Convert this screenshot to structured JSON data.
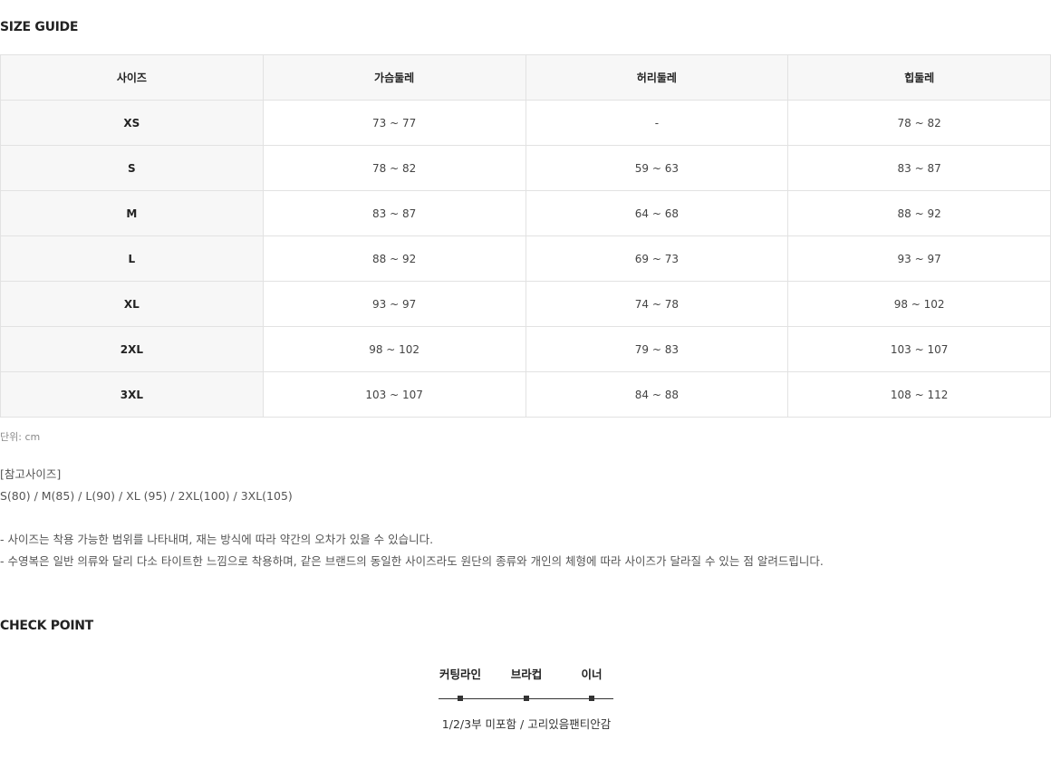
{
  "size_guide": {
    "title": "SIZE GUIDE",
    "headers": [
      "사이즈",
      "가슴둘레",
      "허리둘레",
      "힙둘레"
    ],
    "rows": [
      [
        "XS",
        "73 ~ 77",
        "-",
        "78 ~ 82"
      ],
      [
        "S",
        "78 ~ 82",
        "59 ~ 63",
        "83 ~ 87"
      ],
      [
        "M",
        "83 ~ 87",
        "64 ~ 68",
        "88 ~ 92"
      ],
      [
        "L",
        "88 ~ 92",
        "69 ~ 73",
        "93 ~ 97"
      ],
      [
        "XL",
        "93 ~ 97",
        "74 ~ 78",
        "98 ~ 102"
      ],
      [
        "2XL",
        "98 ~ 102",
        "79 ~ 83",
        "103 ~ 107"
      ],
      [
        "3XL",
        "103 ~ 107",
        "84 ~ 88",
        "108 ~ 112"
      ]
    ],
    "unit": "단위: cm",
    "reference": {
      "label": "[참고사이즈]",
      "sizes": "S(80) / M(85) / L(90) / XL (95) / 2XL(100) / 3XL(105)"
    },
    "notes": [
      "- 사이즈는 착용 가능한 범위를 나타내며, 재는 방식에 따라 약간의 오차가 있을 수 있습니다.",
      "- 수영복은 일반 의류와 달리 다소 타이트한 느낌으로 착용하며, 같은 브랜드의 동일한 사이즈라도 원단의 종류와 개인의 체형에 따라 사이즈가 달라질 수 있는 점 알려드립니다."
    ]
  },
  "check_point": {
    "title": "CHECK POINT",
    "labels": [
      "커팅라인",
      "브라컵",
      "이너"
    ],
    "value": "1/2/3부 미포함 / 고리있음팬티안감"
  }
}
